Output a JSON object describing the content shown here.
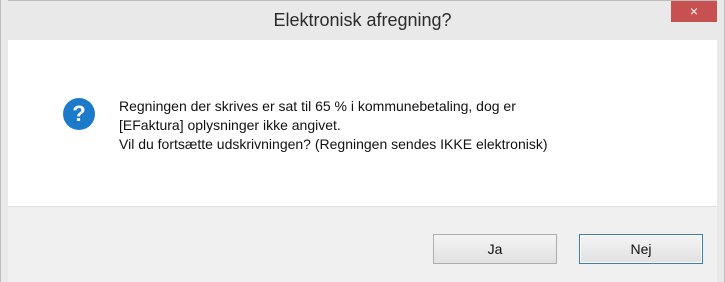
{
  "window": {
    "title": "Elektronisk afregning?",
    "close_label": "×"
  },
  "message": {
    "line1": "Regningen der skrives er sat til 65 % i kommunebetaling, dog er",
    "line2": "[EFaktura] oplysninger ikke angivet.",
    "line3": "Vil du fortsætte udskrivningen? (Regningen sendes IKKE elektronisk)"
  },
  "icon": {
    "name": "question-icon",
    "color": "#1c7acb"
  },
  "buttons": {
    "yes": "Ja",
    "no": "Nej"
  }
}
